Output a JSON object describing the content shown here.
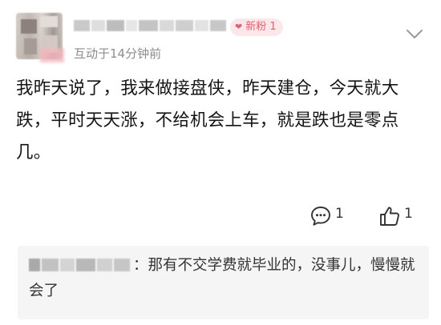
{
  "post": {
    "fans_badge": "新粉 1",
    "time": "互动于14分钟前",
    "content": "我昨天说了，我来做接盘侠，昨天建仓，今天就大跌，平时天天涨，不给机会上车，就是跌也是零点几。"
  },
  "actions": {
    "comment_count": "1",
    "like_count": "1",
    "comment_icon": "comment-bubble-icon",
    "like_icon": "thumbs-up-icon"
  },
  "reply": {
    "text": "：那有不交学费就毕业的，没事儿，慢慢就会了"
  },
  "colors": {
    "badge_bg": "#fde7ea",
    "badge_text": "#e06170",
    "time_text": "#8d8d8d",
    "reply_bg": "#f5f5f5"
  }
}
